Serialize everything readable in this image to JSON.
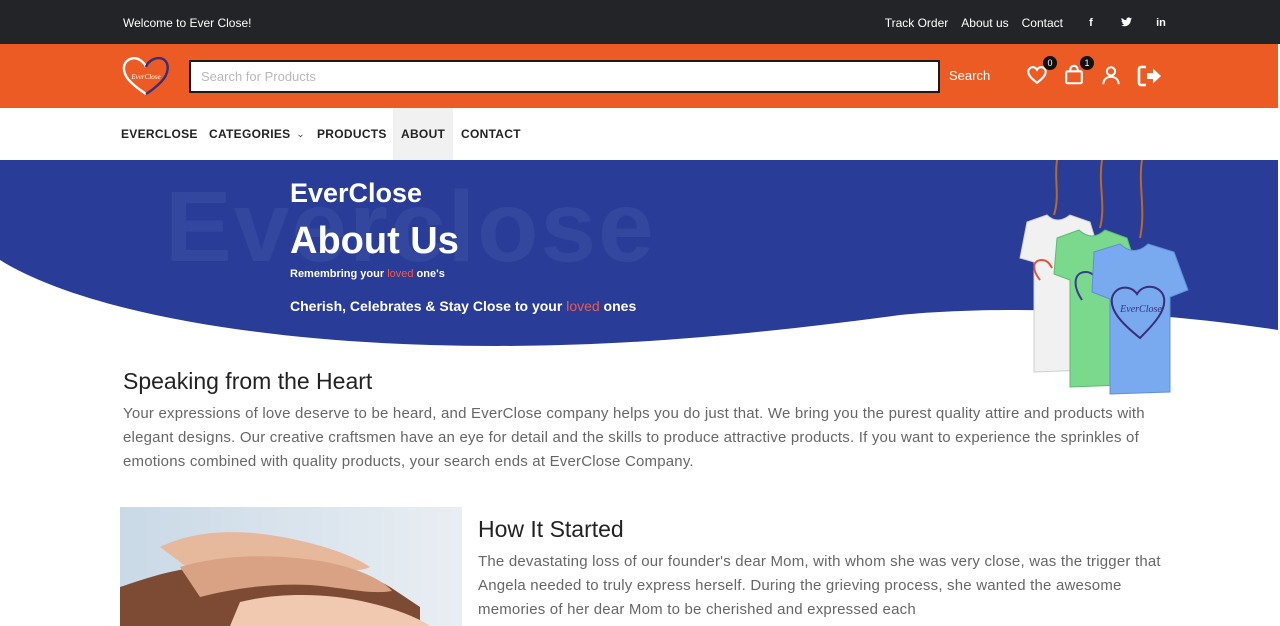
{
  "topbar": {
    "welcome": "Welcome to Ever Close!",
    "links": [
      "Track Order",
      "About us",
      "Contact"
    ],
    "social": [
      "f",
      "t",
      "in"
    ]
  },
  "header": {
    "logo_text": "EverClose",
    "search_placeholder": "Search for Products",
    "search_label": "Search",
    "wishlist_count": "0",
    "cart_count": "1",
    "brand_color": "#ed5b24"
  },
  "nav": {
    "items": [
      "EVERCLOSE",
      "CATEGORIES",
      "PRODUCTS",
      "ABOUT",
      "CONTACT"
    ],
    "categories_caret": "›"
  },
  "hero": {
    "watermark": "Everclose",
    "brand": "EverClose",
    "title": "About Us",
    "sub1_pre": "Remembring your ",
    "sub1_hl": "loved",
    "sub1_post": " one's",
    "sub2_pre": "Cherish, Celebrates & Stay Close to your ",
    "sub2_hl": "loved",
    "sub2_post": " ones",
    "bg_color": "#283c98",
    "shirt_text": "EverClose"
  },
  "section1": {
    "heading": "Speaking from the Heart",
    "body": "Your expressions of love deserve to be heard, and EverClose company helps you do just that. We bring you the purest quality attire and products with elegant designs. Our creative craftsmen have an eye for detail and the skills to produce attractive products. If you want to experience the sprinkles of emotions combined with quality products, your search ends at EverClose Company."
  },
  "section2": {
    "heading": "How It Started",
    "body": "The devastating loss of our founder's dear Mom, with whom she was very close, was the trigger that Angela needed to truly express herself. During the grieving process, she wanted the awesome memories of her dear Mom to be cherished and expressed each"
  }
}
